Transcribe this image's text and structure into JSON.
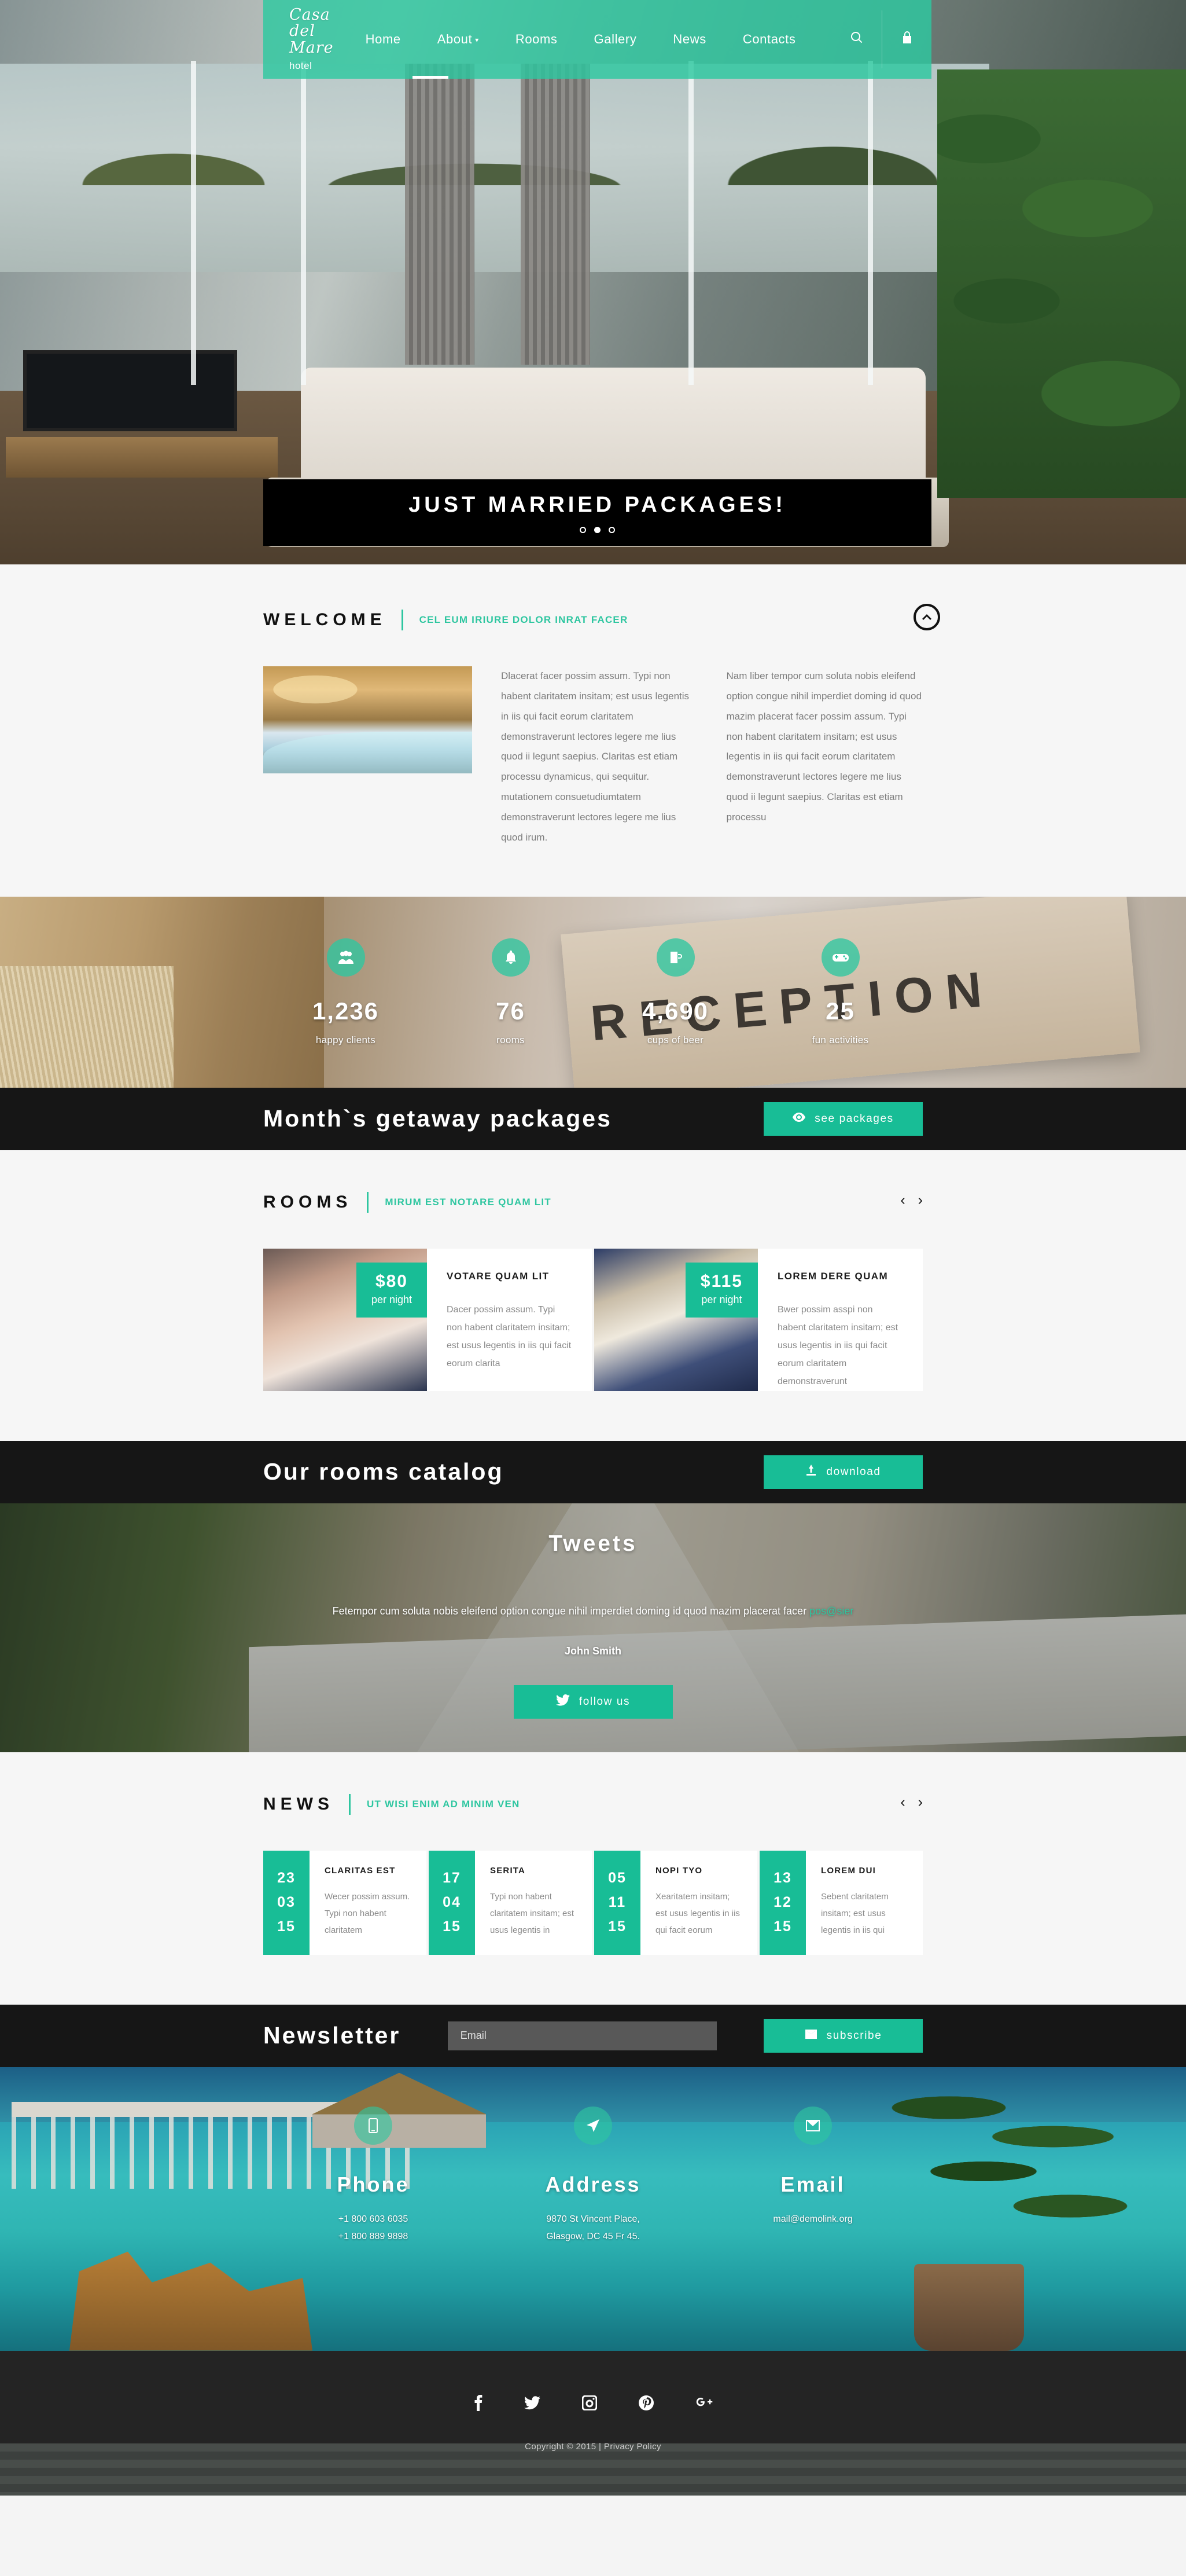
{
  "header": {
    "brand_name": "Casa del Mare",
    "brand_sub": "hotel",
    "nav": [
      {
        "label": "Home",
        "has_caret": false
      },
      {
        "label": "About",
        "has_caret": true
      },
      {
        "label": "Rooms",
        "has_caret": false
      },
      {
        "label": "Gallery",
        "has_caret": false
      },
      {
        "label": "News",
        "has_caret": false
      },
      {
        "label": "Contacts",
        "has_caret": false
      }
    ],
    "search_icon": "search-icon",
    "lock_icon": "lock-icon"
  },
  "hero": {
    "caption": "JUST MARRIED PACKAGES!",
    "slides": 3,
    "active_slide": 2
  },
  "welcome": {
    "title": "WELCOME",
    "subtitle": "CEL EUM IRIURE DOLOR INRAT FACER",
    "col1": "Dlacerat facer possim assum. Typi non habent claritatem insitam; est usus legentis in iis qui facit eorum claritatem demonstraverunt lectores legere me lius quod ii legunt saepius. Claritas est etiam processu dynamicus, qui sequitur. mutationem consuetudiumtatem demonstraverunt lectores legere me lius quod irum.",
    "col2": "Nam liber tempor cum soluta nobis eleifend option congue nihil imperdiet doming id quod mazim placerat facer possim assum. Typi non habent claritatem insitam; est usus legentis in iis qui facit eorum claritatem demonstraverunt lectores legere me lius quod ii legunt saepius. Claritas est etiam processu",
    "scroll_top_icon": "chevron-up-icon"
  },
  "counters": [
    {
      "value": "1,236",
      "label": "happy clients",
      "icon": "users-icon"
    },
    {
      "value": "76",
      "label": "rooms",
      "icon": "bell-icon"
    },
    {
      "value": "4,690",
      "label": "cups of beer",
      "icon": "beer-mug-icon"
    },
    {
      "value": "25",
      "label": "fun activities",
      "icon": "gamepad-icon"
    }
  ],
  "packages_bar": {
    "title": "Month`s getaway packages",
    "button_label": "see packages",
    "button_icon": "eye-icon"
  },
  "rooms": {
    "title": "ROOMS",
    "subtitle": "MIRUM EST NOTARE QUAM LIT",
    "prev_arrow": "‹",
    "next_arrow": "›",
    "items": [
      {
        "price": "$80",
        "per": "per night",
        "name": "VOTARE QUAM LIT",
        "text": "Dacer possim assum. Typi non habent claritatem insitam; est usus legentis in iis qui facit eorum clarita"
      },
      {
        "price": "$115",
        "per": "per night",
        "name": "LOREM DERE QUAM",
        "text": "Bwer possim asspi non habent claritatem insitam; est usus legentis in iis qui facit eorum claritatem demonstraverunt"
      }
    ]
  },
  "catalog_bar": {
    "title": "Our rooms catalog",
    "button_label": "download",
    "button_icon": "download-icon"
  },
  "tweets": {
    "title": "Tweets",
    "text_before": "Fetempor cum soluta nobis eleifend option congue nihil imperdiet doming id quod mazim placerat facer ",
    "link": "pos@sier",
    "author": "John Smith",
    "button_label": "follow us",
    "button_icon": "twitter-icon"
  },
  "news": {
    "title": "NEWS",
    "subtitle": "UT WISI ENIM AD MINIM VEN",
    "prev_arrow": "‹",
    "next_arrow": "›",
    "items": [
      {
        "day": "23",
        "month": "03",
        "year": "15",
        "title": "CLARITAS EST",
        "text": "Wecer possim assum. Typi non habent claritatem"
      },
      {
        "day": "17",
        "month": "04",
        "year": "15",
        "title": "SERITA",
        "text": "Typi non habent claritatem insitam; est usus legentis in"
      },
      {
        "day": "05",
        "month": "11",
        "year": "15",
        "title": "NOPI TYO",
        "text": "Xearitatem insitam; est usus legentis in iis qui facit eorum"
      },
      {
        "day": "13",
        "month": "12",
        "year": "15",
        "title": "LOREM DUI",
        "text": "Sebent claritatem insitam; est usus legentis in iis qui"
      }
    ]
  },
  "newsletter": {
    "title": "Newsletter",
    "input_placeholder": "Email",
    "input_value": "",
    "button_label": "subscribe",
    "button_icon": "envelope-icon"
  },
  "contacts": [
    {
      "icon": "phone-icon",
      "title": "Phone",
      "lines": [
        "+1 800 603 6035",
        "+1 800 889 9898"
      ]
    },
    {
      "icon": "location-arrow-icon",
      "title": "Address",
      "lines": [
        "9870 St Vincent Place,",
        "Glasgow, DC 45 Fr 45."
      ]
    },
    {
      "icon": "envelope-icon",
      "title": "Email",
      "lines": [
        "mail@demolink.org"
      ]
    }
  ],
  "footer": {
    "socials": [
      "facebook-icon",
      "twitter-icon",
      "instagram-icon",
      "pinterest-icon",
      "googleplus-icon"
    ],
    "copyright": "Copyright © 2015 | Privacy Policy"
  },
  "theme": {
    "accent": "#18bd96",
    "accent_light": "#2ec6a0",
    "dark": "#161616"
  }
}
